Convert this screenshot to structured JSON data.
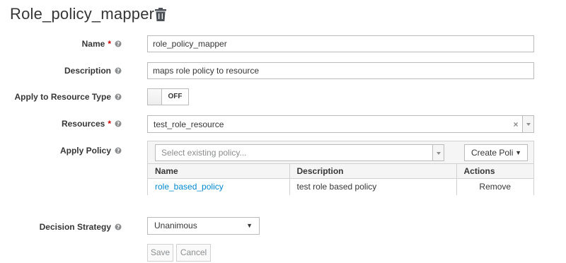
{
  "page": {
    "title": "Role_policy_mapper",
    "delete_icon": "trash-icon"
  },
  "form": {
    "name": {
      "label": "Name",
      "required": "*",
      "value": "role_policy_mapper"
    },
    "description": {
      "label": "Description",
      "value": "maps role policy to resource"
    },
    "apply_resource_type": {
      "label": "Apply to Resource Type",
      "toggle_text": "OFF"
    },
    "resources": {
      "label": "Resources",
      "required": "*",
      "value": "test_role_resource",
      "clear": "×"
    },
    "apply_policy": {
      "label": "Apply Policy",
      "placeholder": "Select existing policy...",
      "create_label": "Create Poli",
      "create_caret": "▼",
      "table": {
        "headers": [
          "Name",
          "Description",
          "Actions"
        ],
        "rows": [
          {
            "name": "role_based_policy",
            "description": "test role based policy",
            "action": "Remove"
          }
        ]
      }
    },
    "decision_strategy": {
      "label": "Decision Strategy",
      "value": "Unanimous",
      "caret": "▼"
    }
  },
  "buttons": {
    "save": "Save",
    "cancel": "Cancel"
  },
  "colors": {
    "required": "#cc0000",
    "link": "#0088ce",
    "border": "#bbbbbb"
  }
}
